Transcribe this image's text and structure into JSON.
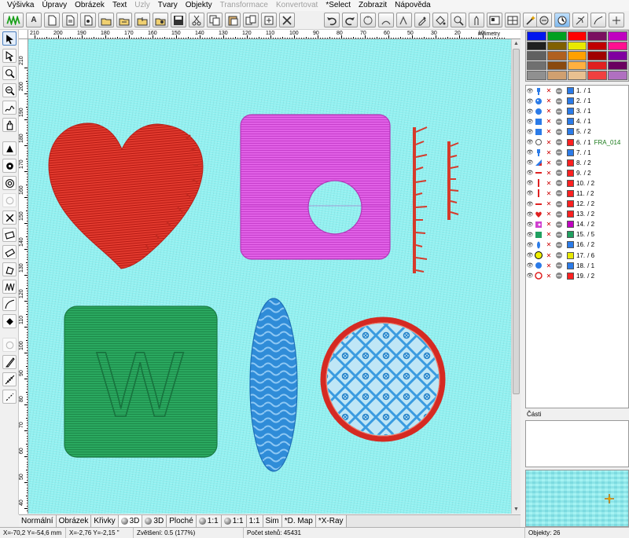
{
  "menu": [
    "Výšivka",
    "Úpravy",
    "Obrázek",
    "Text",
    "Uzly",
    "Tvary",
    "Objekty",
    "Transformace",
    "Konvertovat",
    "*Select",
    "Zobrazit",
    "Nápověda"
  ],
  "menu_disabled": [
    4,
    7,
    8
  ],
  "ruler": {
    "unit": "milimetry",
    "top_labels": [
      "210",
      "200",
      "190",
      "180",
      "170",
      "160",
      "150",
      "140",
      "130",
      "120",
      "110",
      "100",
      "90",
      "80",
      "70",
      "60",
      "50",
      "30",
      "20",
      "10"
    ],
    "left_labels": [
      "210",
      "200",
      "190",
      "180",
      "170",
      "160",
      "150",
      "140",
      "130",
      "120",
      "110",
      "100",
      "90",
      "80",
      "70",
      "60",
      "50",
      "40"
    ]
  },
  "view_tabs": [
    {
      "label": "Normální",
      "dot": false
    },
    {
      "label": "Obrázek",
      "dot": false
    },
    {
      "label": "Křivky",
      "dot": false
    },
    {
      "label": "3D",
      "dot": true,
      "active": true
    },
    {
      "label": "3D",
      "dot": true
    },
    {
      "label": "Ploché",
      "dot": false
    },
    {
      "label": "1:1",
      "dot": true
    },
    {
      "label": "1:1",
      "dot": true
    },
    {
      "label": "1:1",
      "dot": false
    },
    {
      "label": "Sim",
      "dot": false
    },
    {
      "label": "*D. Map",
      "dot": false
    },
    {
      "label": "*X-Ray",
      "dot": false
    }
  ],
  "status": {
    "pos1": "X=-70,2  Y=-54,6 mm",
    "pos2": "X=-2,76  Y=-2,15 \"",
    "zoom": "Zvětšení: 0.5 (177%)",
    "stitches": "Počet stehů: 45431",
    "objects": "Objekty: 26"
  },
  "palette": [
    "#0016ee",
    "#00a020",
    "#ff0000",
    "#7a1060",
    "#c000c0",
    "#202020",
    "#806000",
    "#e8e800",
    "#c00000",
    "#ff1090",
    "#606060",
    "#b06020",
    "#ffa000",
    "#a00000",
    "#8000a0",
    "#707070",
    "#8a4a10",
    "#ffb040",
    "#e02020",
    "#6a0060",
    "#909090",
    "#d0a070",
    "#e8c090",
    "#f04040",
    "#b070c0"
  ],
  "objects": [
    {
      "n": "1.",
      "part": "/ 1",
      "color": "#2b7be8",
      "shape": "key"
    },
    {
      "n": "2.",
      "part": "/ 1",
      "color": "#2b7be8",
      "shape": "face"
    },
    {
      "n": "3.",
      "part": "/ 1",
      "color": "#2b7be8",
      "shape": "circle"
    },
    {
      "n": "4.",
      "part": "/ 1",
      "color": "#2b7be8",
      "shape": "square"
    },
    {
      "n": "5.",
      "part": "/ 2",
      "color": "#2b7be8",
      "shape": "square"
    },
    {
      "n": "6.",
      "part": "/ 1",
      "color": "#ff2020",
      "shape": "ring",
      "tag": "FRA_014"
    },
    {
      "n": "7.",
      "part": "/ 1",
      "color": "#2b7be8",
      "shape": "key"
    },
    {
      "n": "8.",
      "part": "/ 2",
      "color": "#ff2020",
      "shape": "tri"
    },
    {
      "n": "9.",
      "part": "/ 2",
      "color": "#ff2020",
      "shape": "bar"
    },
    {
      "n": "10.",
      "part": "/ 2",
      "color": "#ff2020",
      "shape": "line"
    },
    {
      "n": "11.",
      "part": "/ 2",
      "color": "#ff2020",
      "shape": "line"
    },
    {
      "n": "12.",
      "part": "/ 2",
      "color": "#ff2020",
      "shape": "bar"
    },
    {
      "n": "13.",
      "part": "/ 2",
      "color": "#ff2020",
      "shape": "heart"
    },
    {
      "n": "14.",
      "part": "/ 2",
      "color": "#c000c0",
      "shape": "magenta"
    },
    {
      "n": "15.",
      "part": "/ 5",
      "color": "#20a060",
      "shape": "green"
    },
    {
      "n": "16.",
      "part": "/ 2",
      "color": "#2b7be8",
      "shape": "oval"
    },
    {
      "n": "17.",
      "part": "/ 6",
      "color": "#e8e800",
      "shape": "yellow"
    },
    {
      "n": "18.",
      "part": "/ 1",
      "color": "#2b7be8",
      "shape": "circle"
    },
    {
      "n": "19.",
      "part": "/ 2",
      "color": "#ff2020",
      "shape": "redring"
    }
  ],
  "parts_label": "Části",
  "embroidery_letter": "W"
}
